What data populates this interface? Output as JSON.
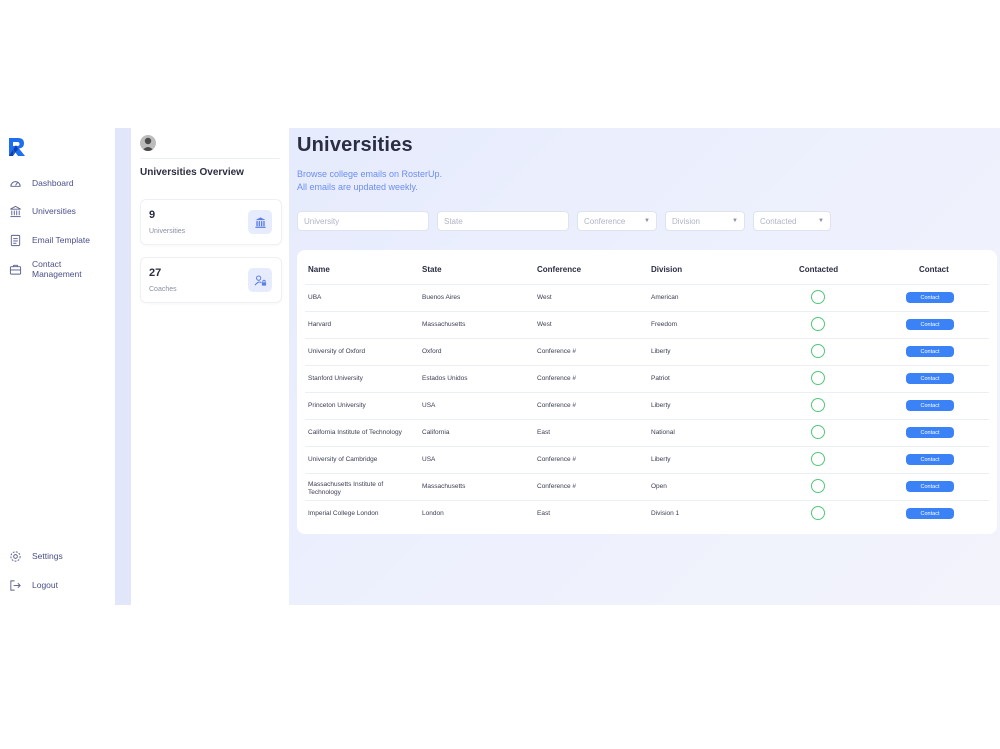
{
  "nav": {
    "items": [
      {
        "label": "Dashboard",
        "icon": "dashboard-gauge-icon"
      },
      {
        "label": "Universities",
        "icon": "bank-icon"
      },
      {
        "label": "Email Template",
        "icon": "document-icon"
      },
      {
        "label": "Contact Management",
        "icon": "briefcase-icon"
      }
    ],
    "bottom": [
      {
        "label": "Settings",
        "icon": "gear-icon"
      },
      {
        "label": "Logout",
        "icon": "logout-icon"
      }
    ]
  },
  "overview": {
    "title": "Universities Overview",
    "stats": [
      {
        "value": "9",
        "label": "Universities",
        "icon": "bank-icon"
      },
      {
        "value": "27",
        "label": "Coaches",
        "icon": "user-lock-icon"
      }
    ]
  },
  "main": {
    "title": "Universities",
    "subtitle_line1": "Browse college emails on RosterUp.",
    "subtitle_line2": "All emails are updated weekly.",
    "filters": {
      "university_placeholder": "University",
      "state_placeholder": "State",
      "conference": "Conference",
      "division": "Division",
      "contacted": "Contacted"
    },
    "table": {
      "headers": {
        "name": "Name",
        "state": "State",
        "conference": "Conference",
        "division": "Division",
        "contacted": "Contacted",
        "contact": "Contact"
      },
      "button_label": "Contact",
      "rows": [
        {
          "name": "UBA",
          "state": "Buenos Aires",
          "conference": "West",
          "division": "American"
        },
        {
          "name": "Harvard",
          "state": "Massachusetts",
          "conference": "West",
          "division": "Freedom"
        },
        {
          "name": "University of Oxford",
          "state": "Oxford",
          "conference": "Conference #",
          "division": "Liberty"
        },
        {
          "name": "Stanford University",
          "state": "Estados Unidos",
          "conference": "Conference #",
          "division": "Patriot"
        },
        {
          "name": "Princeton University",
          "state": "USA",
          "conference": "Conference #",
          "division": "Liberty"
        },
        {
          "name": "California Institute of Technology",
          "state": "California",
          "conference": "East",
          "division": "National"
        },
        {
          "name": "University of Cambridge",
          "state": "USA",
          "conference": "Conference #",
          "division": "Liberty"
        },
        {
          "name": "Massachusetts Institute of Technology",
          "state": "Massachusetts",
          "conference": "Conference #",
          "division": "Open"
        },
        {
          "name": "Imperial College London",
          "state": "London",
          "conference": "East",
          "division": "Division 1"
        }
      ]
    }
  },
  "colors": {
    "accent": "#3b82f6",
    "brand_blue": "#1f6ff0",
    "contacted_ring": "#54c77a",
    "nav_text": "#4a4f8a"
  }
}
